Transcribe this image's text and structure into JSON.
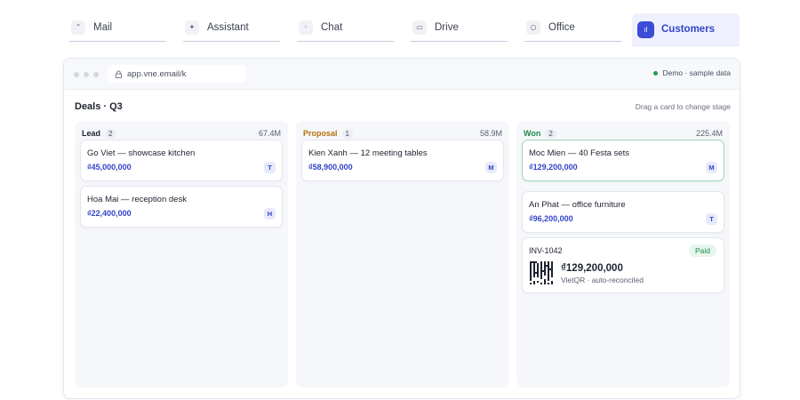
{
  "tabs": [
    {
      "label": "Mail",
      "icon": "mail-icon",
      "glyph": "⌃"
    },
    {
      "label": "Assistant",
      "icon": "sparkle-icon",
      "glyph": "✦"
    },
    {
      "label": "Chat",
      "icon": "chat-icon",
      "glyph": "◦"
    },
    {
      "label": "Drive",
      "icon": "folder-icon",
      "glyph": "▭"
    },
    {
      "label": "Office",
      "icon": "circle-icon",
      "glyph": "○"
    },
    {
      "label": "Customers",
      "icon": "chart-icon",
      "glyph": "ıl",
      "active": true
    }
  ],
  "browser": {
    "url": "app.vne.email/k",
    "demo_label": "Demo · sample data"
  },
  "board": {
    "title": "Deals · Q3",
    "hint": "Drag a card to change stage"
  },
  "columns": [
    {
      "name": "Lead",
      "count": "2",
      "total": "67.4M",
      "color": "#1f2330",
      "cards": [
        {
          "title": "Go Viet — showcase kitchen",
          "amount": "₫45,000,000",
          "avatar": "T"
        },
        {
          "title": "Hoa Mai — reception desk",
          "amount": "₫22,400,000",
          "avatar": "H"
        }
      ]
    },
    {
      "name": "Proposal",
      "count": "1",
      "total": "58.9M",
      "color": "#b5730a",
      "cards": [
        {
          "title": "Kien Xanh — 12 meeting tables",
          "amount": "₫58,900,000",
          "avatar": "M"
        }
      ]
    },
    {
      "name": "Won",
      "count": "2",
      "total": "225.4M",
      "color": "#1f8a4c",
      "cards": [
        {
          "title": "Moc Mien — 40 Festa sets",
          "amount": "₫129,200,000",
          "avatar": "M"
        },
        {
          "title": "An Phat — office furniture",
          "amount": "₫96,200,000",
          "avatar": "T"
        }
      ],
      "invoice": {
        "id": "INV-1042",
        "status": "Paid",
        "amount": "₫129,200,000",
        "note": "VietQR · auto-reconciled"
      }
    }
  ],
  "colors": {
    "accent": "#3344c9",
    "won_green": "#1f8a4c",
    "proposal_amber": "#b5730a"
  }
}
